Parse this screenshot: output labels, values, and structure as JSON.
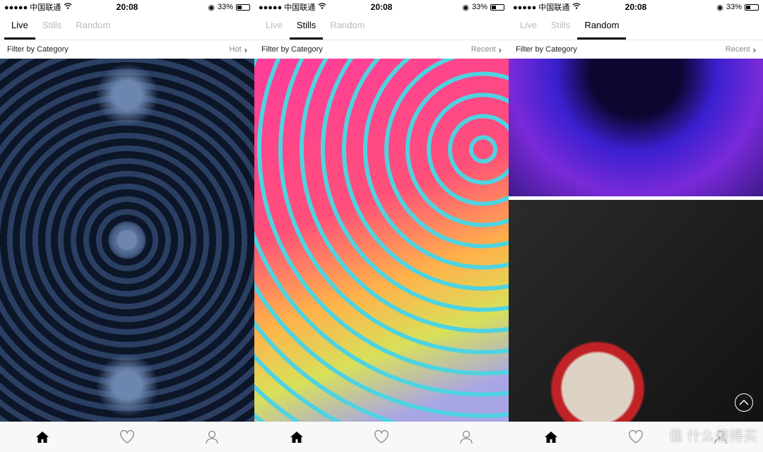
{
  "status": {
    "carrier": "●●●●● 中国联通",
    "time": "20:08",
    "battery": "33%",
    "battery_level": 0.33
  },
  "tabs": [
    "Live",
    "Stills",
    "Random"
  ],
  "filter_label": "Filter by Category",
  "screens": [
    {
      "active_tab": 0,
      "sort": "Hot"
    },
    {
      "active_tab": 1,
      "sort": "Recent"
    },
    {
      "active_tab": 2,
      "sort": "Recent"
    }
  ],
  "watermark": "值 什么值得买",
  "icons": {
    "home": "home-icon",
    "favorites": "heart-icon",
    "profile": "person-icon",
    "scroll_top": "chevron-up-circle-icon",
    "wifi": "wifi-icon",
    "lock": "rotation-lock-icon"
  }
}
